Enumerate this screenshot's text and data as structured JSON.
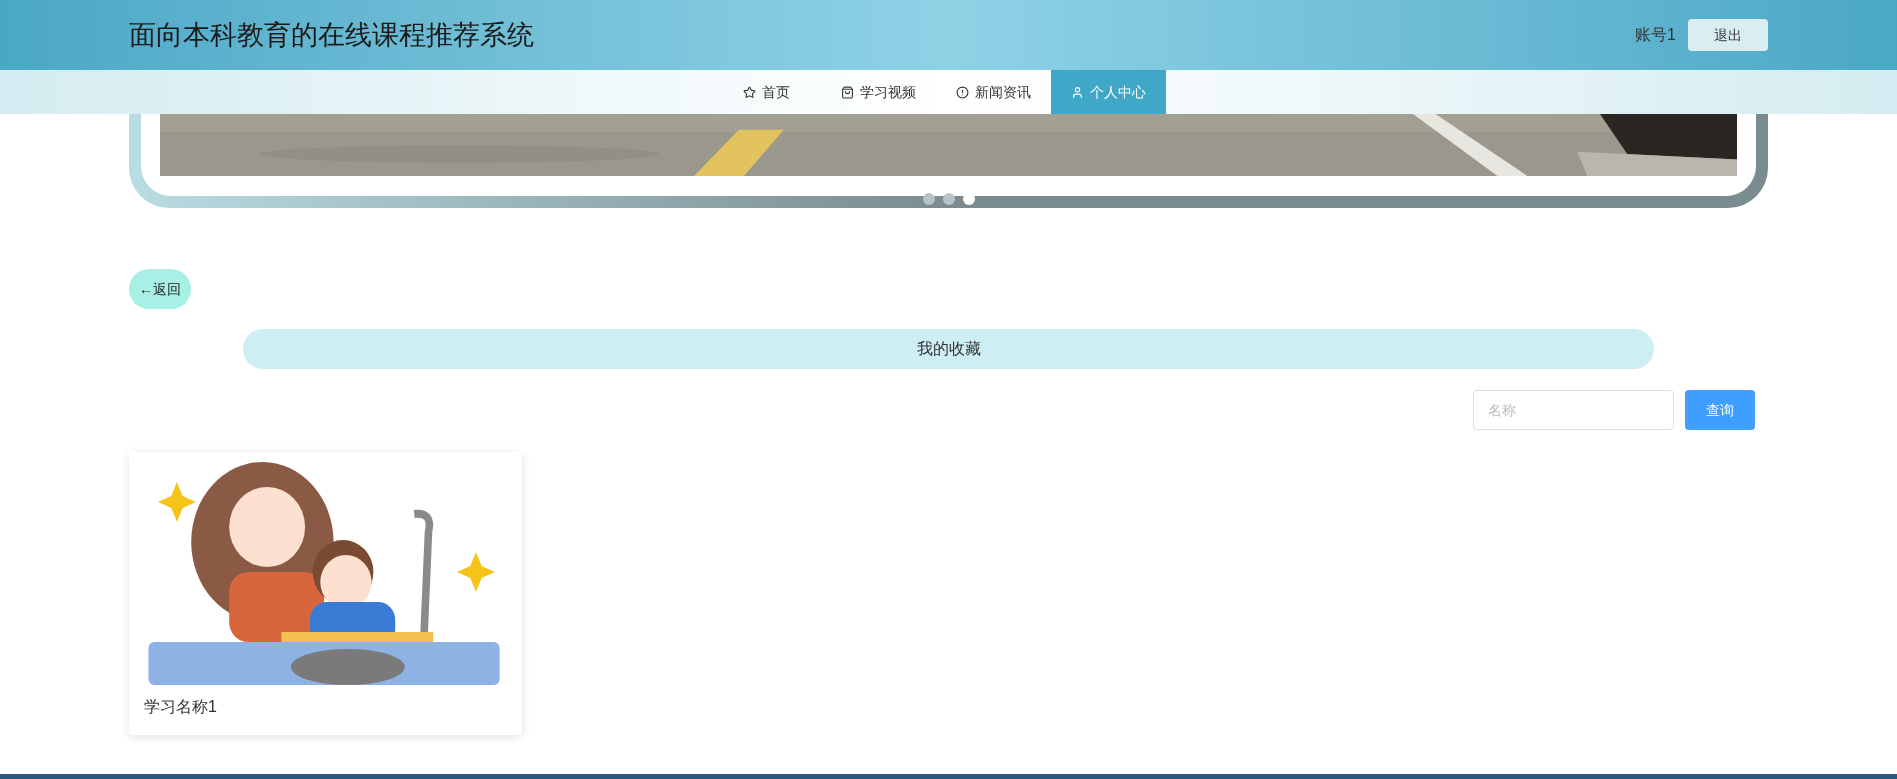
{
  "header": {
    "title": "面向本科教育的在线课程推荐系统",
    "account": "账号1",
    "logout": "退出"
  },
  "nav": [
    {
      "label": "首页",
      "selected": false
    },
    {
      "label": "学习视频",
      "selected": false
    },
    {
      "label": "新闻资讯",
      "selected": false
    },
    {
      "label": "个人中心",
      "selected": true
    }
  ],
  "carousel": {
    "dots": [
      {
        "selected": false
      },
      {
        "selected": false
      },
      {
        "selected": true
      }
    ]
  },
  "back_button": "←返回",
  "section_title": "我的收藏",
  "search": {
    "placeholder": "名称",
    "button": "查询"
  },
  "cards": [
    {
      "title": "学习名称1"
    }
  ]
}
